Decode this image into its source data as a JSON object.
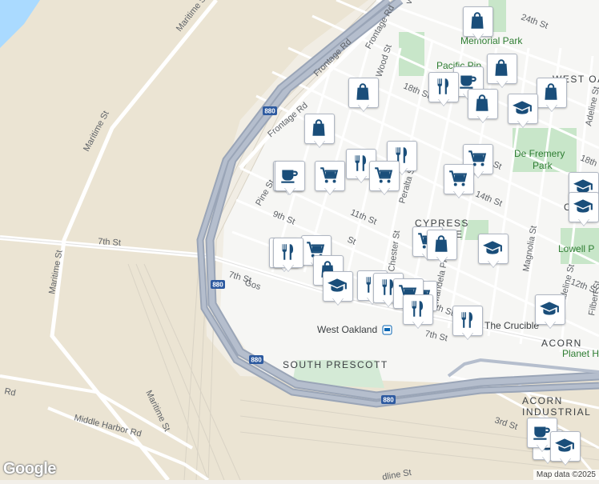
{
  "streets": {
    "maritime_1": "Maritime St",
    "maritime_2": "Maritime St",
    "maritime_3": "Maritime St",
    "maritime_4": "Maritime St",
    "seventh_west": "7th St",
    "seventh_mid": "7th St",
    "seventh_east": "7th St",
    "frontage_1": "Frontage Rd",
    "frontage_2": "Frontage Rd",
    "frontage_3": "Frontage Rd",
    "wood": "Wood St",
    "pine": "Pine St",
    "ninth": "9th St",
    "eleventh": "11th St",
    "peralta": "Peralta St",
    "chester": "Chester St",
    "mandela": "Mandela Pkwy",
    "magnolia": "Magnolia St",
    "adeline_1": "Adeline St",
    "adeline_2": "Adeline St",
    "filbert": "Filbert St",
    "eighteenth": "18th St",
    "eighteenth_e": "18th",
    "fourteenth": "14th St",
    "twentyfourth": "24th St",
    "twelfth": "12th St",
    "third": "3rd St",
    "middle_harbor": "Middle Harbor Rd",
    "wolf": "ve",
    "goss": "Gos",
    "st_short": "St",
    "st_short2": "St",
    "adeline_bottom": "dline St",
    "rd_left": "Rd",
    "eighth": "8th St"
  },
  "areas": {
    "west_oakland_area": "WEST OAKL",
    "cypress_1": "CYPRESS",
    "cypress_2": "E",
    "oak": "OAK",
    "south_prescott": "SOUTH PRESCOTT",
    "acorn": "ACORN",
    "acorn_industrial_1": "ACORN",
    "acorn_industrial_2": "INDUSTRIAL",
    "st_partial": "C"
  },
  "places": {
    "memorial_park": "Memorial Park",
    "pacific_pipe": "Pacific Pip",
    "de_fremery_1": "De Fremery",
    "de_fremery_2": "Park",
    "lowell": "Lowell P",
    "crucible": "The Crucible",
    "planet": "Planet H",
    "west_oakland_station": "West Oakland"
  },
  "highways": {
    "i880_a": "880",
    "i880_b": "880",
    "i880_c": "880",
    "i880_d": "880"
  },
  "pins": [
    {
      "type": "shopping-bag",
      "name": "pin-shopping-1"
    },
    {
      "type": "cafe",
      "name": "pin-cafe-1"
    },
    {
      "type": "shopping-bag",
      "name": "pin-shopping-2"
    },
    {
      "type": "restaurant",
      "name": "pin-restaurant-1"
    },
    {
      "type": "cafe",
      "name": "pin-cafe-2"
    },
    {
      "type": "shopping-bag",
      "name": "pin-shopping-3"
    },
    {
      "type": "shopping-bag",
      "name": "pin-shopping-4"
    },
    {
      "type": "school",
      "name": "pin-school-1"
    },
    {
      "type": "shopping-bag",
      "name": "pin-shopping-5"
    },
    {
      "type": "shopping-bag",
      "name": "pin-shopping-6"
    },
    {
      "type": "cafe",
      "name": "pin-cafe-3"
    },
    {
      "type": "shopping-cart",
      "name": "pin-cart-1"
    },
    {
      "type": "restaurant",
      "name": "pin-restaurant-2"
    },
    {
      "type": "restaurant",
      "name": "pin-restaurant-3"
    },
    {
      "type": "shopping-cart",
      "name": "pin-cart-2"
    },
    {
      "type": "shopping-cart",
      "name": "pin-cart-3"
    },
    {
      "type": "shopping-cart",
      "name": "pin-cart-4"
    },
    {
      "type": "school",
      "name": "pin-school-2"
    },
    {
      "type": "shopping-cart",
      "name": "pin-cart-5"
    },
    {
      "type": "shopping-bag",
      "name": "pin-shopping-7"
    },
    {
      "type": "school",
      "name": "pin-school-3"
    },
    {
      "type": "restaurant",
      "name": "pin-restaurant-4"
    },
    {
      "type": "shopping-cart",
      "name": "pin-cart-6"
    },
    {
      "type": "restaurant",
      "name": "pin-restaurant-5"
    },
    {
      "type": "shopping-cart",
      "name": "pin-cart-7"
    },
    {
      "type": "shopping-bag",
      "name": "pin-shopping-8"
    },
    {
      "type": "school",
      "name": "pin-school-4"
    },
    {
      "type": "restaurant",
      "name": "pin-restaurant-6"
    },
    {
      "type": "restaurant",
      "name": "pin-restaurant-7"
    },
    {
      "type": "shopping-cart",
      "name": "pin-cart-8"
    },
    {
      "type": "restaurant",
      "name": "pin-restaurant-8"
    },
    {
      "type": "school",
      "name": "pin-school-5"
    },
    {
      "type": "restaurant",
      "name": "pin-restaurant-9"
    },
    {
      "type": "school",
      "name": "pin-school-6"
    },
    {
      "type": "school",
      "name": "pin-school-7"
    },
    {
      "type": "cafe",
      "name": "pin-cafe-4"
    },
    {
      "type": "school",
      "name": "pin-school-8"
    }
  ],
  "google": "Google",
  "attribution": "Map data ©2025",
  "colors": {
    "pin_icon": "#1a4e7a",
    "water": "#aadaff",
    "park": "#c8e6c9",
    "highway": "#8e9aae",
    "land_industrial": "#ede6d6"
  }
}
